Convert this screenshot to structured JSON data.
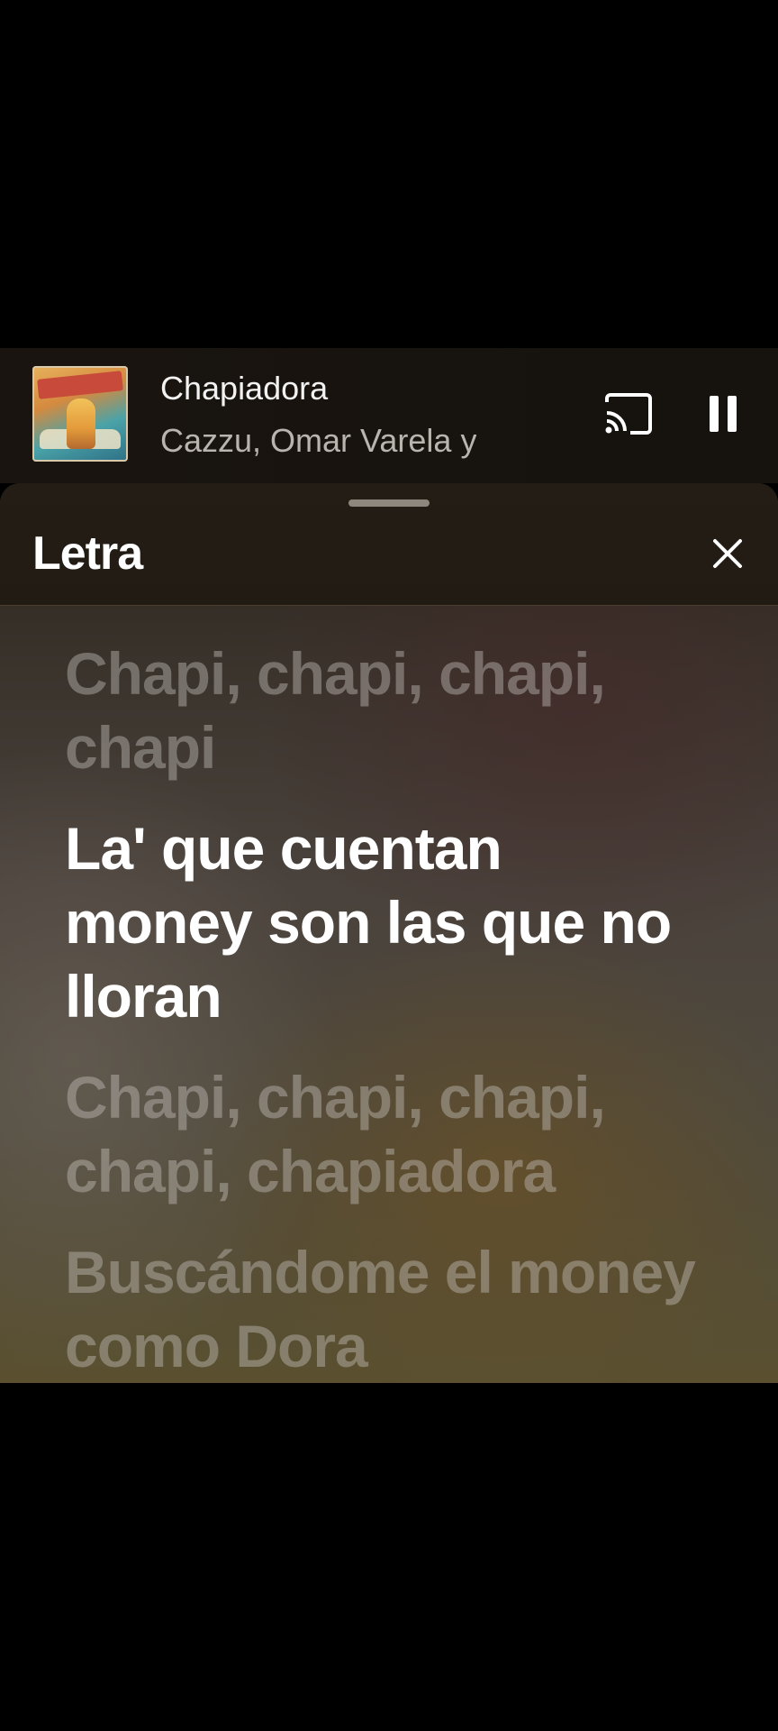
{
  "mini_player": {
    "title": "Chapiadora",
    "artist": "Cazzu, Omar Varela y",
    "cast_icon": "cast-icon",
    "pause_icon": "pause-icon"
  },
  "lyrics_panel": {
    "title": "Letra",
    "close_icon": "close-icon",
    "lines": [
      {
        "text": "Chapi, chapi, chapi, chapi",
        "active": false
      },
      {
        "text": "La' que cuentan money son las que no lloran",
        "active": true
      },
      {
        "text": "Chapi, chapi, chapi, chapi, chapiadora",
        "active": false
      },
      {
        "text": "Buscándome el money como Dora",
        "active": false
      }
    ]
  }
}
